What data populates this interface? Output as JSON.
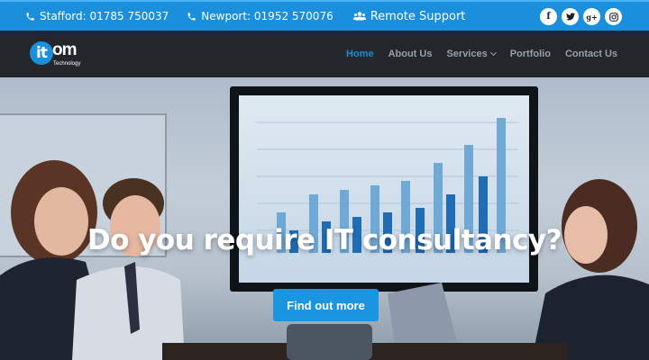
{
  "topbar": {
    "stafford": "Stafford: 01785 750037",
    "newport": "Newport: 01952 570076",
    "support": "Remote Support",
    "social_icons": [
      "facebook-icon",
      "twitter-icon",
      "google-plus-icon",
      "instagram-icon"
    ]
  },
  "logo": {
    "mark": "it",
    "name": "om",
    "tagline": "Technology"
  },
  "nav": {
    "items": [
      {
        "label": "Home",
        "active": true
      },
      {
        "label": "About Us"
      },
      {
        "label": "Services",
        "dropdown": true
      },
      {
        "label": "Portfolio"
      },
      {
        "label": "Contact Us"
      }
    ]
  },
  "hero": {
    "headline": "Do you require IT consultancy?",
    "cta": "Find out more"
  },
  "colors": {
    "accent": "#1a8fdc",
    "nav_bg": "#23262b",
    "nav_text": "#9aa0a8"
  }
}
